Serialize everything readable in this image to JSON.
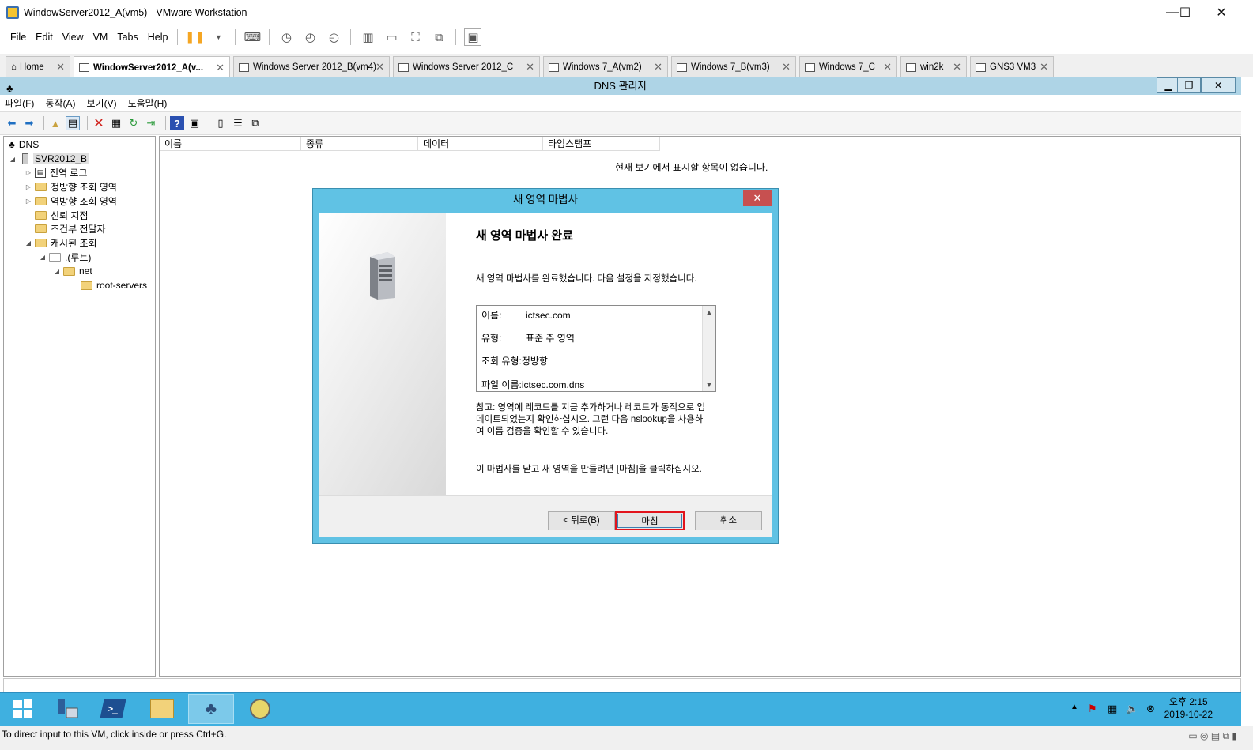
{
  "vm_window": {
    "title": "WindowServer2012_A(vm5) - VMware Workstation",
    "controls": [
      "—",
      "☐",
      "✕"
    ]
  },
  "vm_menu": [
    "File",
    "Edit",
    "View",
    "VM",
    "Tabs",
    "Help"
  ],
  "vm_tabs": [
    {
      "label": "Home",
      "active": false
    },
    {
      "label": "WindowServer2012_A(v...",
      "active": true
    },
    {
      "label": "Windows Server 2012_B(vm4)",
      "active": false
    },
    {
      "label": "Windows Server 2012_C",
      "active": false
    },
    {
      "label": "Windows 7_A(vm2)",
      "active": false
    },
    {
      "label": "Windows 7_B(vm3)",
      "active": false
    },
    {
      "label": "Windows 7_C",
      "active": false
    },
    {
      "label": "win2k",
      "active": false
    },
    {
      "label": "GNS3 VM3",
      "active": false
    }
  ],
  "dns_manager": {
    "title": "DNS 관리자",
    "menu": [
      "파일(F)",
      "동작(A)",
      "보기(V)",
      "도움말(H)"
    ],
    "tree": {
      "root": "DNS",
      "server": "SVR2012_B",
      "items": [
        "전역 로그",
        "정방향 조회 영역",
        "역방향 조회 영역",
        "신뢰 지점",
        "조건부 전달자",
        "캐시된 조회"
      ],
      "cache_root": ".(루트)",
      "net": "net",
      "root_servers": "root-servers"
    },
    "list_columns": [
      "이름",
      "종류",
      "데이터",
      "타임스탬프"
    ],
    "empty_message": "현재 보기에서 표시할 항목이 없습니다."
  },
  "wizard": {
    "title": "새 영역 마법사",
    "heading": "새 영역 마법사 완료",
    "description": "새 영역 마법사를 완료했습니다. 다음 설정을 지정했습니다.",
    "summary": [
      {
        "label": "이름:",
        "value": "ictsec.com"
      },
      {
        "label": "유형:",
        "value": "표준 주 영역"
      },
      {
        "label": "조회 유형:",
        "value": "정방향"
      },
      {
        "label": "파일 이름:",
        "value": "ictsec.com.dns"
      }
    ],
    "note_lines": [
      "참고: 영역에 레코드를 지금 추가하거나 레코드가 동적으로 업",
      "데이트되었는지 확인하십시오. 그런 다음 nslookup을 사용하",
      "여 이름 검증을 확인할 수 있습니다."
    ],
    "final_text": "이 마법사를 닫고 새 영역을 만들려면 [마침]을 클릭하십시오.",
    "buttons": {
      "back": "< 뒤로(B)",
      "finish": "마침",
      "cancel": "취소"
    }
  },
  "taskbar": {
    "clock_time": "오후 2:15",
    "clock_date": "2019-10-22"
  },
  "vm_status": "To direct input to this VM, click inside or press Ctrl+G."
}
